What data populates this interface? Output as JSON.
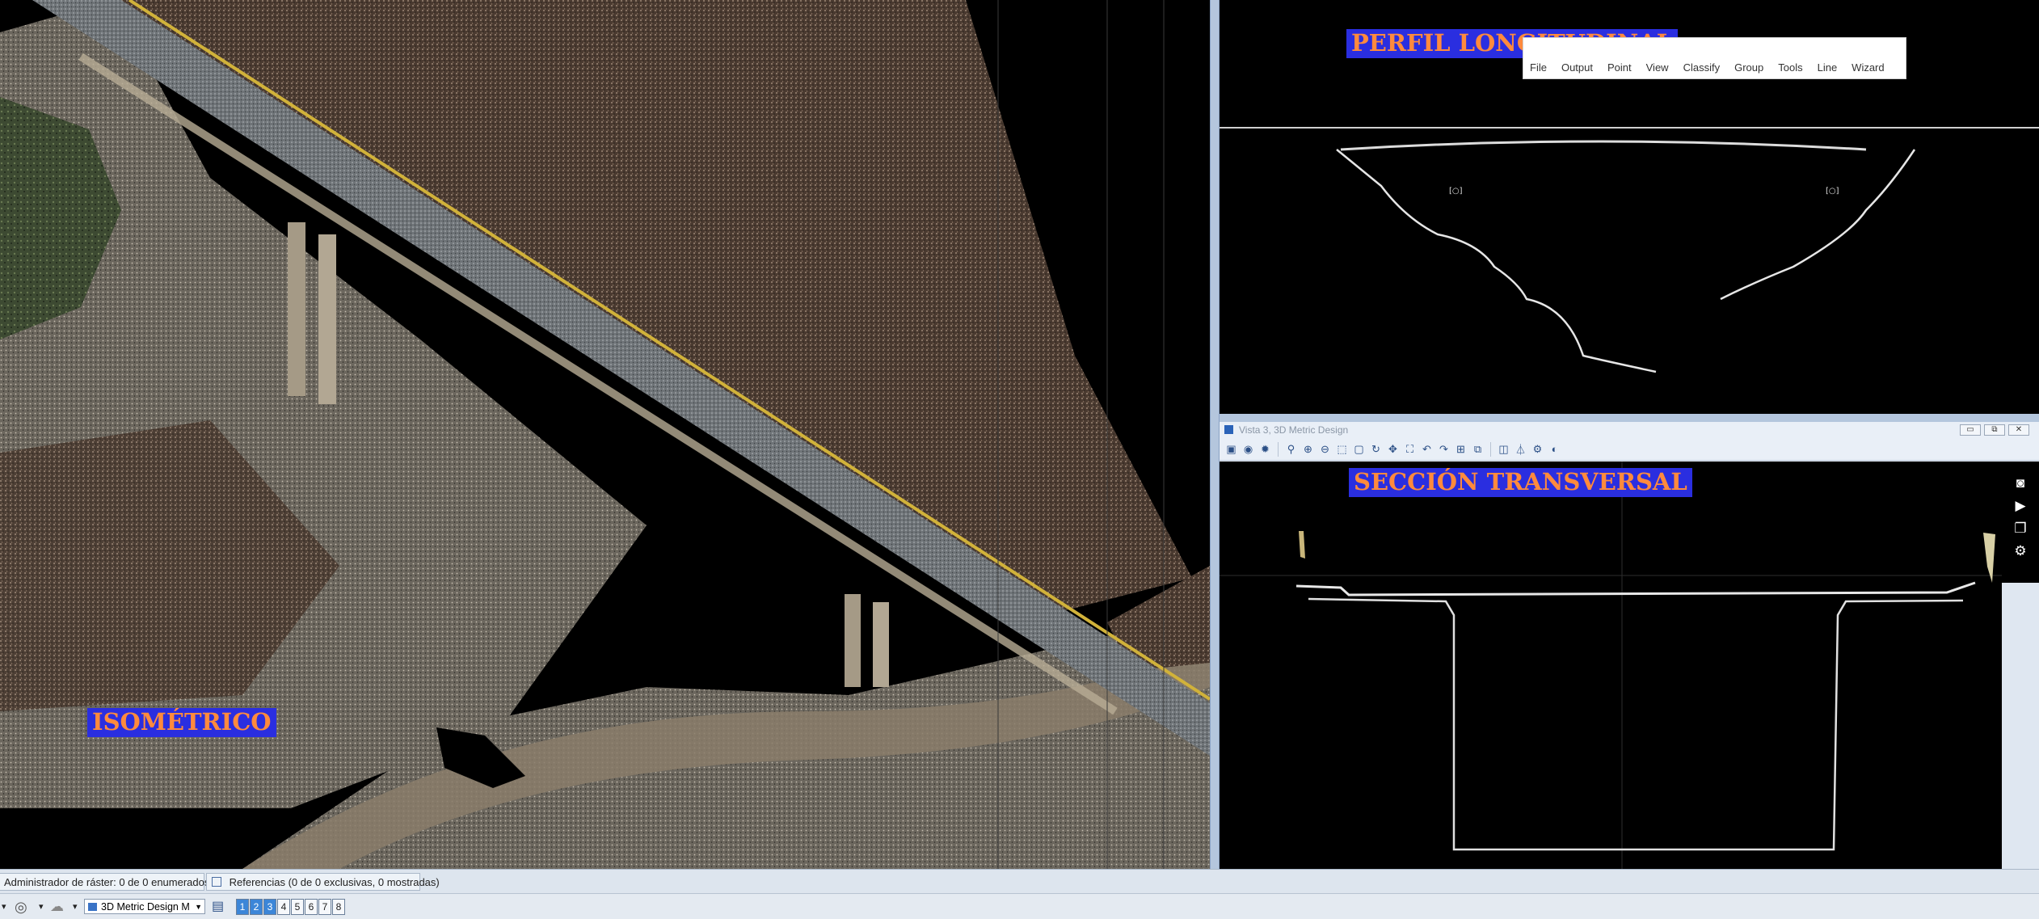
{
  "views": {
    "isometric_label": "ISOMÉTRICO",
    "profile_label": "PERFIL LONGITUDINAL",
    "section_label": "SECCIÓN TRANSVERSAL"
  },
  "floating_menu": [
    "File",
    "Output",
    "Point",
    "View",
    "Classify",
    "Group",
    "Tools",
    "Line",
    "Wizard"
  ],
  "view3": {
    "title": "Vista 3, 3D Metric Design",
    "buttons": {
      "minimize": "▭",
      "restore": "⧉",
      "close": "✕"
    }
  },
  "view3_toolbar_icons": [
    "view-attributes-icon",
    "render-icon",
    "settings-icon",
    "measure-icon",
    "zoom-in-icon",
    "zoom-out-icon",
    "fit-view-icon",
    "window-area-icon",
    "rotate-icon",
    "pan-icon",
    "walk-icon",
    "undo-view-icon",
    "redo-view-icon",
    "toggle-view-icon",
    "copy-view-icon",
    "clip-volume-icon",
    "filter-icon",
    "level-icon",
    "display-style-icon"
  ],
  "view_tools": [
    "camera-icon",
    "video-icon",
    "layers-icon",
    "gear-icon"
  ],
  "status": {
    "raster_manager": "Administrador de ráster: 0 de 0 enumerados",
    "references": "Referencias (0 de 0 exclusivas, 0 mostradas)"
  },
  "bottom": {
    "design_model": "3D Metric Design M",
    "view_numbers": [
      "1",
      "2",
      "3",
      "4",
      "5",
      "6",
      "7",
      "8"
    ],
    "active_views": [
      "1",
      "2",
      "3"
    ]
  },
  "colors": {
    "label_bg": "#2a2ee0",
    "label_text": "#ff8a3d",
    "viewport_bg": "#000000",
    "chrome": "#dfe7f1"
  }
}
